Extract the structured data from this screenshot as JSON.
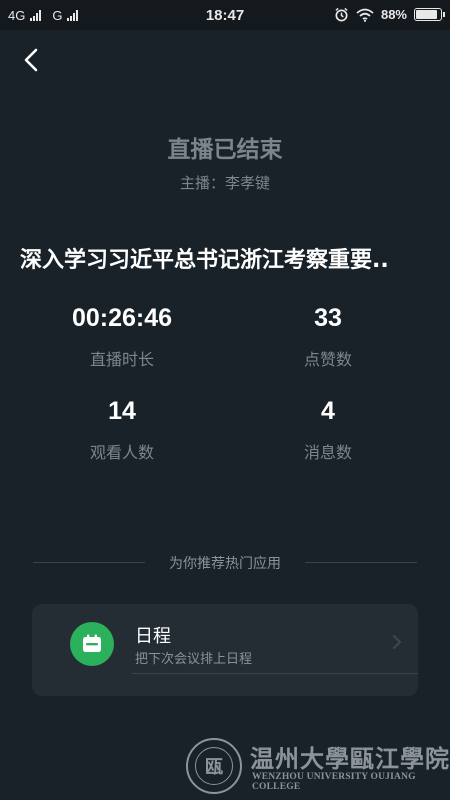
{
  "status_bar": {
    "network_1": "4G",
    "network_2": "G",
    "time": "18:47",
    "battery_percent": "88%",
    "battery_level": 0.88,
    "icons": [
      "alarm-icon",
      "wifi-icon",
      "battery-icon"
    ]
  },
  "header": {
    "back_icon": "chevron-left-icon"
  },
  "summary": {
    "end_title": "直播已结束",
    "host": "主播：李孝键",
    "live_title": "深入学习习近平总书记浙江考察重要.."
  },
  "stats": [
    {
      "value": "00:26:46",
      "label": "直播时长"
    },
    {
      "value": "33",
      "label": "点赞数"
    },
    {
      "value": "14",
      "label": "观看人数"
    },
    {
      "value": "4",
      "label": "消息数"
    }
  ],
  "recommend": {
    "heading": "为你推荐热门应用",
    "apps": [
      {
        "title": "日程",
        "subtitle": "把下次会议排上日程",
        "icon": "calendar-icon",
        "icon_color": "#2bb15b"
      }
    ]
  },
  "footer": {
    "seal_text": "瓯",
    "name_cn": "温州大學甌江學院",
    "name_en": "WENZHOU UNIVERSITY OUJIANG COLLEGE"
  },
  "colors": {
    "background": "#1a2229",
    "card": "#242c34",
    "muted_text": "#7d858c",
    "accent_green": "#2bb15b"
  }
}
